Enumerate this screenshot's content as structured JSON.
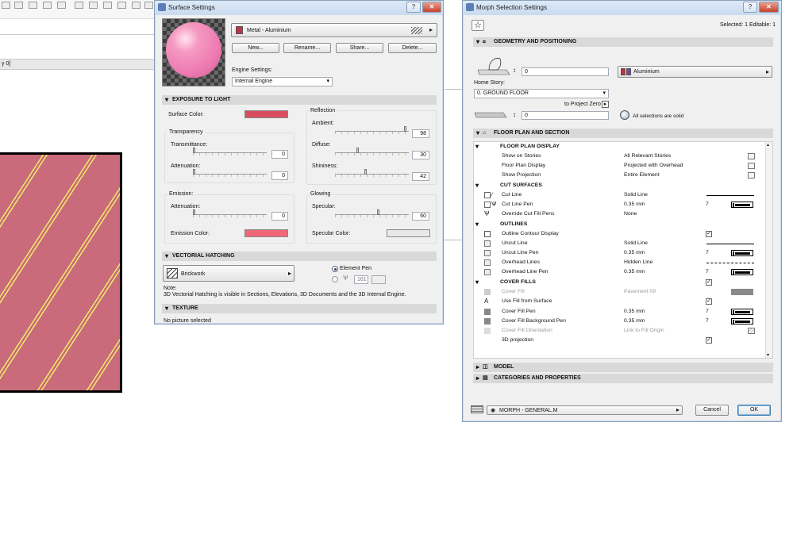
{
  "background": {
    "ruler_text": "y 0]"
  },
  "surface_settings": {
    "title": "Surface Settings",
    "material_name": "Metal - Aluminium",
    "buttons": {
      "new": "New...",
      "rename": "Rename...",
      "share": "Share...",
      "delete": "Delete..."
    },
    "engine_settings_label": "Engine Settings:",
    "engine_value": "Internal Engine",
    "sections": {
      "exposure": "EXPOSURE TO LIGHT",
      "vectorial": "VECTORIAL HATCHING",
      "texture": "TEXTURE"
    },
    "surface_color_label": "Surface Color:",
    "surface_color": "#d94e5f",
    "transparency_label": "Transparency",
    "transmittance_label": "Transmittance:",
    "transmittance_value": "0",
    "transmittance_level": 0,
    "attenuation_label": "Attenuation:",
    "attenuation_value": "0",
    "attenuation_level": 0,
    "reflection_label": "Reflection",
    "ambient_label": "Ambient:",
    "ambient_value": "98",
    "ambient_level": 0.98,
    "diffuse_label": "Diffuse:",
    "diffuse_value": "30",
    "diffuse_level": 0.3,
    "shininess_label": "Shininess:",
    "shininess_value": "42",
    "shininess_level": 0.42,
    "emission_label": "Emission:",
    "emission_attenuation_label": "Attenuation:",
    "emission_attenuation_value": "0",
    "emission_attenuation_level": 0,
    "emission_color_label": "Emission Color:",
    "emission_color": "#f0677a",
    "glowing_label": "Glowing",
    "specular_label": "Specular:",
    "specular_value": "60",
    "specular_level": 0.6,
    "specular_color_label": "Specular Color:",
    "specular_color": "#e8e8e8",
    "hatch_name": "Brickwork",
    "element_pen_label": "Element Pen",
    "pen_number": "161",
    "note_label": "Note:",
    "note_text": "3D Vectorial Hatching is visible in Sections, Elevations, 3D Documents and the 3D Internal Engine.",
    "texture_status": "No picture selected"
  },
  "morph": {
    "title": "Morph Selection Settings",
    "selected_info": "Selected: 1 Editable: 1",
    "geometry_section": "GEOMETRY AND POSITIONING",
    "height_value": "0",
    "material": "Aluminium",
    "home_story_label": "Home Story:",
    "home_story_value": "0. GROUND FLOOR",
    "to_project_zero": "to Project Zero",
    "offset_value": "0",
    "solid_note": "All selections are solid",
    "floor_plan_section": "FLOOR PLAN AND SECTION",
    "groups": {
      "floor_plan_display": "FLOOR PLAN DISPLAY",
      "cut_surfaces": "CUT SURFACES",
      "outlines": "OUTLINES",
      "cover_fills": "COVER FILLS"
    },
    "rows": {
      "show_on_stories": {
        "label": "Show on Stories",
        "value": "All Relevant Stories"
      },
      "floor_plan_display": {
        "label": "Floor Plan Display",
        "value": "Projected with Overhead"
      },
      "show_projection": {
        "label": "Show Projection",
        "value": "Entire Element"
      },
      "cut_line": {
        "label": "Cut Line",
        "value": "Solid Line"
      },
      "cut_line_pen": {
        "label": "Cut Line Pen",
        "value": "0.35 mm",
        "num": "7"
      },
      "override_cut_fill_pens": {
        "label": "Override Cut Fill Pens",
        "value": "None"
      },
      "outline_contour_display": {
        "label": "Outline Contour Display"
      },
      "uncut_line": {
        "label": "Uncut Line",
        "value": "Solid Line"
      },
      "uncut_line_pen": {
        "label": "Uncut Line Pen",
        "value": "0.35 mm",
        "num": "7"
      },
      "overhead_lines": {
        "label": "Overhead Lines",
        "value": "Hidden Line"
      },
      "overhead_line_pen": {
        "label": "Overhead Line Pen",
        "value": "0.35 mm",
        "num": "7"
      },
      "cover_fill": {
        "label": "Cover Fill",
        "value": "Pavement 09"
      },
      "use_fill_from_surface": {
        "label": "Use Fill from Surface"
      },
      "cover_fill_pen": {
        "label": "Cover Fill Pen",
        "value": "0.35 mm",
        "num": "7"
      },
      "cover_fill_background_pen": {
        "label": "Cover Fill Background Pen",
        "value": "0.35 mm",
        "num": "7"
      },
      "cover_fill_orientation": {
        "label": "Cover Fill Orientation",
        "value": "Link to Fill Origin"
      },
      "projection_3d": {
        "label": "3D projection"
      }
    },
    "model_section": "MODEL",
    "categories_section": "CATEGORIES AND PROPERTIES",
    "favorite_value": "MORPH - GENERAL.M",
    "cancel_label": "Cancel",
    "ok_label": "OK"
  }
}
